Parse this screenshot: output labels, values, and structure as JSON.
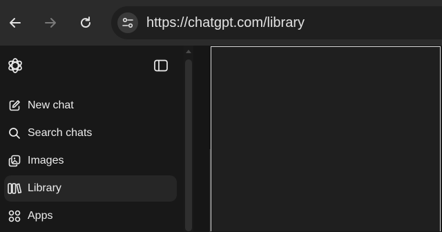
{
  "browser": {
    "url": "https://chatgpt.com/library",
    "icons": {
      "back": "arrow-left-icon",
      "forward": "arrow-right-icon",
      "reload": "reload-icon",
      "site_info": "tune-icon"
    }
  },
  "sidebar": {
    "logo": "openai-logo-icon",
    "toggle": "sidebar-toggle-icon",
    "items": [
      {
        "label": "New chat",
        "icon": "edit-icon",
        "active": false
      },
      {
        "label": "Search chats",
        "icon": "search-icon",
        "active": false
      },
      {
        "label": "Images",
        "icon": "images-icon",
        "active": false
      },
      {
        "label": "Library",
        "icon": "library-icon",
        "active": true
      },
      {
        "label": "Apps",
        "icon": "apps-icon",
        "active": false
      }
    ]
  },
  "colors": {
    "browser_bar": "#2b2b2b",
    "sidebar_bg": "#181818",
    "active_item": "#262626",
    "text": "#ececec"
  }
}
